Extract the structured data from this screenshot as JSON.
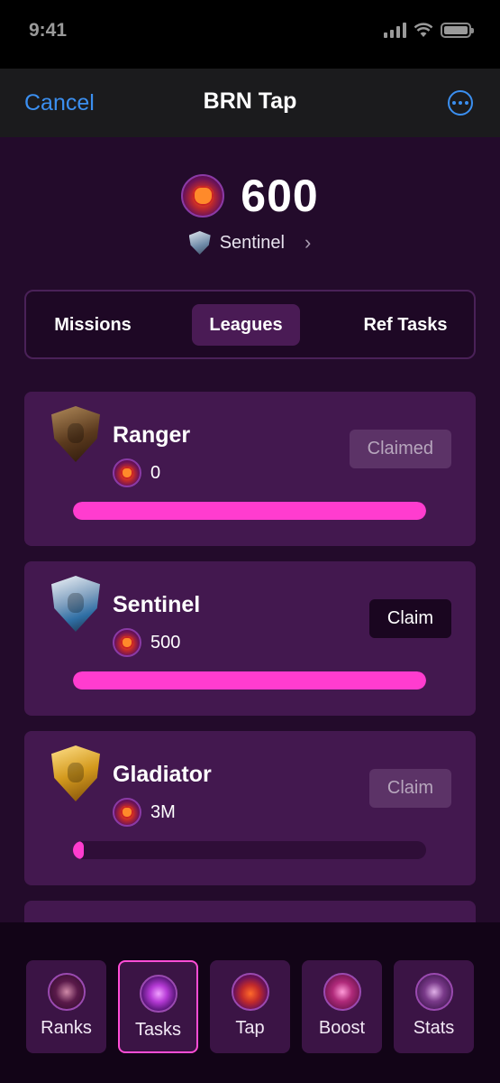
{
  "status_bar": {
    "time": "9:41"
  },
  "nav": {
    "cancel_label": "Cancel",
    "title": "BRN Tap",
    "more_icon": "ellipsis-circle-icon",
    "accent_color": "#3b8ff0"
  },
  "balance": {
    "value": "600",
    "rank": "Sentinel"
  },
  "tabs": [
    {
      "label": "Missions",
      "active": false
    },
    {
      "label": "Leagues",
      "active": true
    },
    {
      "label": "Ref Tasks",
      "active": false
    }
  ],
  "leagues": [
    {
      "name": "Ranger",
      "reward": "0",
      "button": "Claimed",
      "button_state": "disabled",
      "progress": 1.0,
      "icon": "bronze-shield-icon"
    },
    {
      "name": "Sentinel",
      "reward": "500",
      "button": "Claim",
      "button_state": "active",
      "progress": 1.0,
      "icon": "silver-shield-icon"
    },
    {
      "name": "Gladiator",
      "reward": "3M",
      "button": "Claim",
      "button_state": "disabled",
      "progress": 0.02,
      "icon": "gold-shield-icon"
    }
  ],
  "bottom_nav": [
    {
      "label": "Ranks",
      "icon": "ranks-icon",
      "active": false
    },
    {
      "label": "Tasks",
      "icon": "tasks-icon",
      "active": true
    },
    {
      "label": "Tap",
      "icon": "tap-icon",
      "active": false
    },
    {
      "label": "Boost",
      "icon": "boost-icon",
      "active": false
    },
    {
      "label": "Stats",
      "icon": "stats-icon",
      "active": false
    }
  ],
  "colors": {
    "progress_fill": "#ff3ccf",
    "active_tab_border": "#ff4dd6",
    "card_bg": "#43184f"
  }
}
